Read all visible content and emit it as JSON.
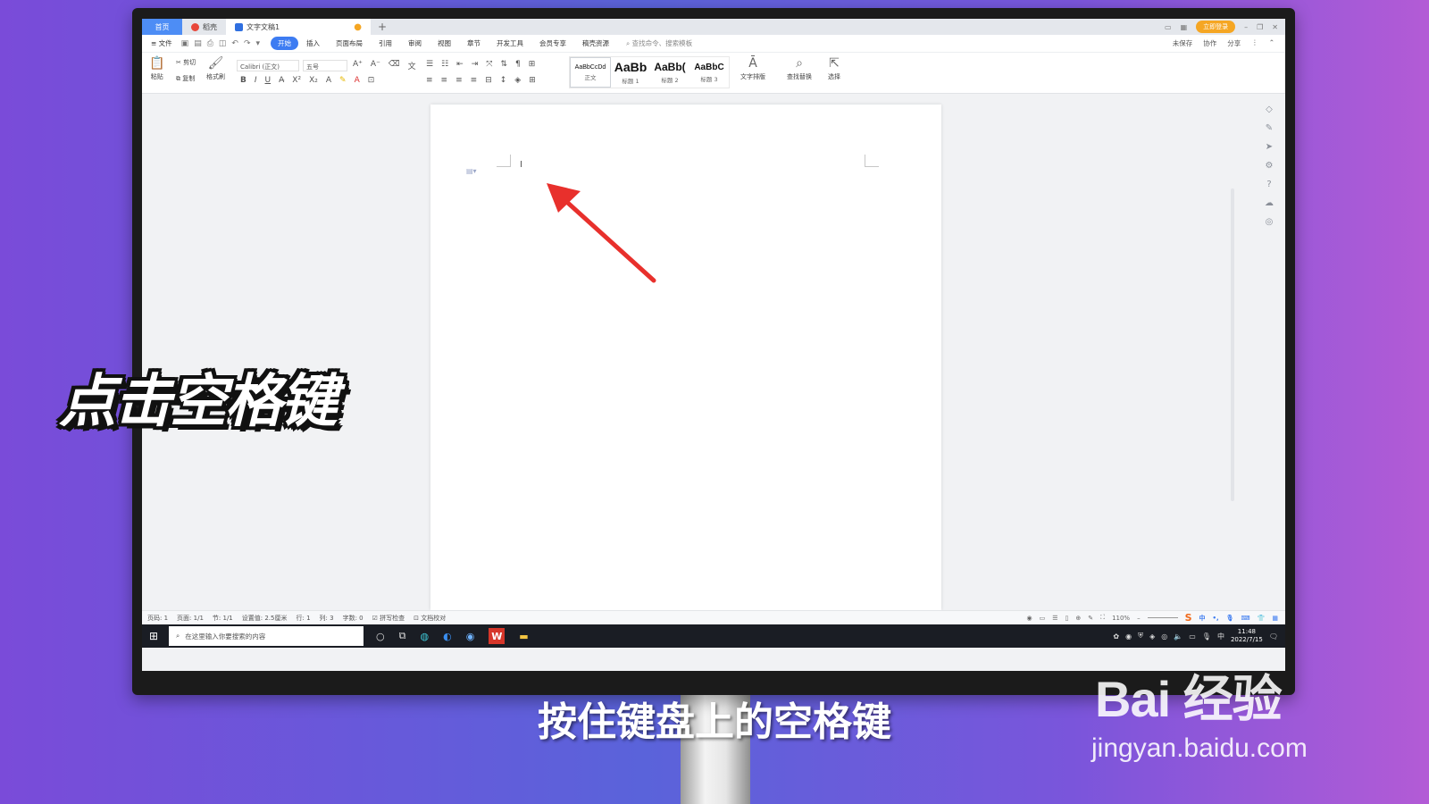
{
  "tabs": {
    "home": "首页",
    "daoke": "稻壳",
    "doc": "文字文稿1",
    "plus": "+",
    "login": "立即登录"
  },
  "menu": {
    "file": "≡ 文件",
    "items": [
      "开始",
      "插入",
      "页面布局",
      "引用",
      "审阅",
      "视图",
      "章节",
      "开发工具",
      "会员专享",
      "稿壳资源"
    ],
    "search": "查找命令、搜索模板",
    "right": [
      "未保存",
      "协作",
      "分享"
    ]
  },
  "ribbon": {
    "paste": "粘贴",
    "cut": "剪切",
    "copy": "复制",
    "format_painter": "格式刷",
    "font": "Calibri (正文)",
    "size": "五号",
    "styles": [
      {
        "sample": "AaBbCcDd",
        "label": "正文"
      },
      {
        "sample": "AaBb",
        "label": "标题 1"
      },
      {
        "sample": "AaBb(",
        "label": "标题 2"
      },
      {
        "sample": "AaBbC",
        "label": "标题 3"
      }
    ],
    "text_layout": "文字排版",
    "find_replace": "查找替换",
    "select": "选择"
  },
  "status": {
    "page_num": "页码: 1",
    "pages": "页面: 1/1",
    "section": "节: 1/1",
    "setting": "设置值: 2.5厘米",
    "row": "行: 1",
    "col": "列: 3",
    "words": "字数: 0",
    "spell": "拼写检查",
    "proof": "文档校对",
    "zoom": "110%"
  },
  "taskbar": {
    "search_placeholder": "在这里输入你要搜索的内容",
    "time": "11:48",
    "date": "2022/7/15",
    "ime": "中"
  },
  "overlay": {
    "title": "点击空格键",
    "subtitle": "按住键盘上的空格键"
  },
  "watermark": {
    "brand": "Bai 经验",
    "url": "jingyan.baidu.com"
  },
  "colors": {
    "accent": "#3d7cf2",
    "arrow": "#e8302c",
    "wps_red": "#d6362a"
  }
}
